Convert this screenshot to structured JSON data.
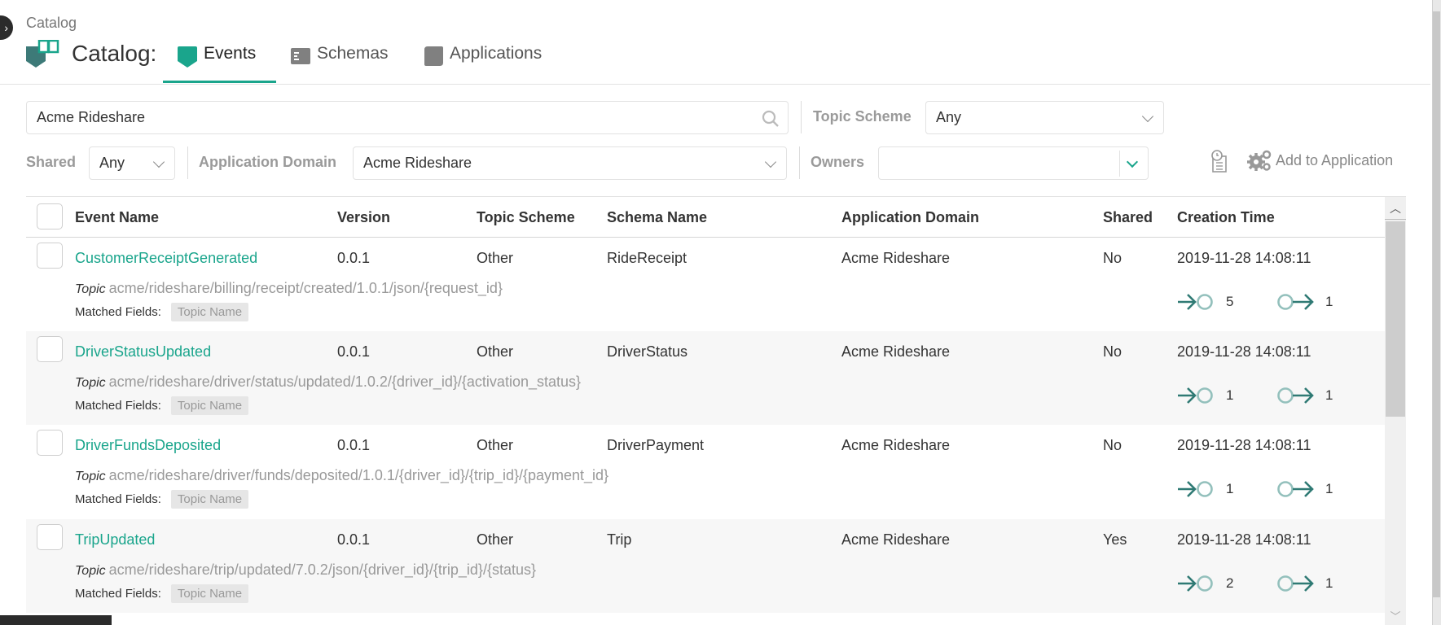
{
  "breadcrumb": "Catalog",
  "title": "Catalog:",
  "tabs": [
    {
      "label": "Events",
      "icon": "event-icon",
      "active": true
    },
    {
      "label": "Schemas",
      "icon": "schema-icon",
      "active": false
    },
    {
      "label": "Applications",
      "icon": "application-icon",
      "active": false
    }
  ],
  "filters": {
    "search_value": "Acme Rideshare",
    "topic_scheme_label": "Topic Scheme",
    "topic_scheme_value": "Any",
    "shared_label": "Shared",
    "shared_value": "Any",
    "app_domain_label": "Application Domain",
    "app_domain_value": "Acme Rideshare",
    "owners_label": "Owners",
    "owners_value": ""
  },
  "toolbar": {
    "add_to_application": "Add to Application"
  },
  "table": {
    "columns": [
      "Event Name",
      "Version",
      "Topic Scheme",
      "Schema Name",
      "Application Domain",
      "Shared",
      "Creation Time"
    ],
    "topic_prefix": "Topic",
    "matched_label": "Matched Fields:",
    "rows": [
      {
        "name": "CustomerReceiptGenerated",
        "version": "0.0.1",
        "topic_scheme": "Other",
        "schema": "RideReceipt",
        "domain": "Acme Rideshare",
        "shared": "No",
        "created": "2019-11-28 14:08:11",
        "topic": "acme/rideshare/billing/receipt/created/1.0.1/json/{request_id}",
        "matched": "Topic Name",
        "subscribers": "5",
        "publishers": "1"
      },
      {
        "name": "DriverStatusUpdated",
        "version": "0.0.1",
        "topic_scheme": "Other",
        "schema": "DriverStatus",
        "domain": "Acme Rideshare",
        "shared": "No",
        "created": "2019-11-28 14:08:11",
        "topic": "acme/rideshare/driver/status/updated/1.0.2/{driver_id}/{activation_status}",
        "matched": "Topic Name",
        "subscribers": "1",
        "publishers": "1"
      },
      {
        "name": "DriverFundsDeposited",
        "version": "0.0.1",
        "topic_scheme": "Other",
        "schema": "DriverPayment",
        "domain": "Acme Rideshare",
        "shared": "No",
        "created": "2019-11-28 14:08:11",
        "topic": "acme/rideshare/driver/funds/deposited/1.0.1/{driver_id}/{trip_id}/{payment_id}",
        "matched": "Topic Name",
        "subscribers": "1",
        "publishers": "1"
      },
      {
        "name": "TripUpdated",
        "version": "0.0.1",
        "topic_scheme": "Other",
        "schema": "Trip",
        "domain": "Acme Rideshare",
        "shared": "Yes",
        "created": "2019-11-28 14:08:11",
        "topic": "acme/rideshare/trip/updated/7.0.2/json/{driver_id}/{trip_id}/{status}",
        "matched": "Topic Name",
        "subscribers": "2",
        "publishers": "1"
      }
    ]
  },
  "colors": {
    "accent": "#1aa58c",
    "icon_dark": "#3d7a78"
  }
}
